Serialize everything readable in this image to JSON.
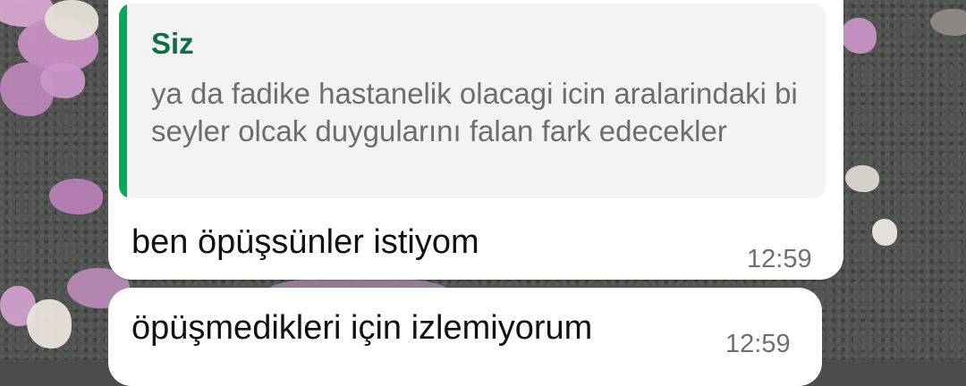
{
  "chat": {
    "messages": [
      {
        "reply_to": {
          "author": "Siz",
          "text": "ya da fadike hastanelik olacagi icin aralarindaki bi seyler olcak duygularını falan fark edecekler"
        },
        "text": "ben öpüşsünler istiyom",
        "time": "12:59"
      },
      {
        "text": "öpüşmedikleri için izlemiyorum",
        "time": "12:59"
      }
    ]
  },
  "colors": {
    "bubble": "#ffffff",
    "quote_bar": "#06a85a",
    "quote_author": "#0b7043",
    "quote_background": "#f3f3f3"
  }
}
